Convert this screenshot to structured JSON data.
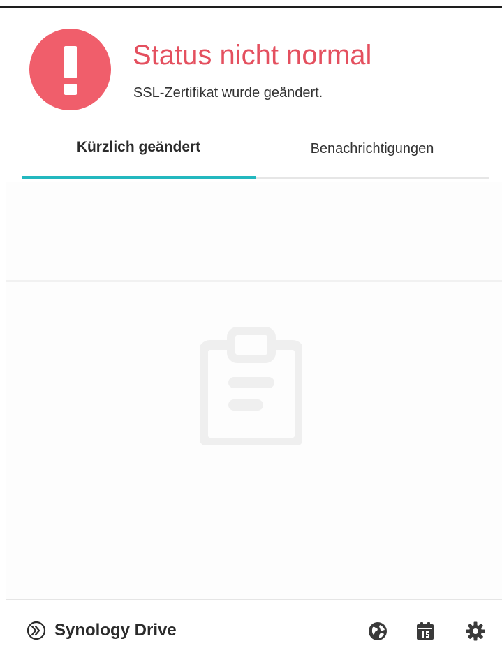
{
  "status": {
    "icon": "exclamation-icon",
    "title": "Status nicht normal",
    "subtitle": "SSL-Zertifikat wurde geändert.",
    "color": "#f05e6b"
  },
  "tabs": [
    {
      "label": "Kürzlich geändert",
      "active": true
    },
    {
      "label": "Benachrichtigungen",
      "active": false
    }
  ],
  "accent_color": "#23b8bf",
  "empty_state": {
    "icon": "clipboard-icon"
  },
  "footer": {
    "brand_icon": "synology-drive-logo-icon",
    "brand_name": "Synology Drive",
    "buttons": [
      {
        "icon": "globe-icon"
      },
      {
        "icon": "calendar-icon"
      },
      {
        "icon": "gear-icon"
      }
    ]
  }
}
